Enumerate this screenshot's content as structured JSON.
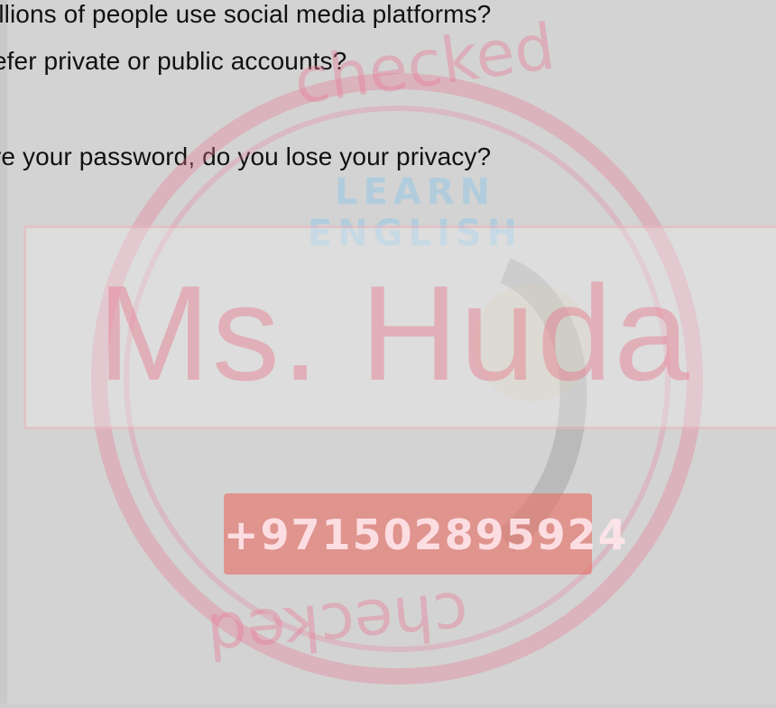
{
  "questions": [
    "illions of people use social media platforms?",
    "efer private or public accounts?",
    "re your password, do you lose your privacy?"
  ],
  "watermark": {
    "stamp_top": "Checked",
    "stamp_bottom": "Checked",
    "tagline": "LEARN ENGLISH",
    "name": "Ms. Huda",
    "phone": "+971502895924",
    "colors": {
      "stamp": "#e87896",
      "tagline": "#96c8e6",
      "phone_bg": "#e66e64"
    }
  }
}
